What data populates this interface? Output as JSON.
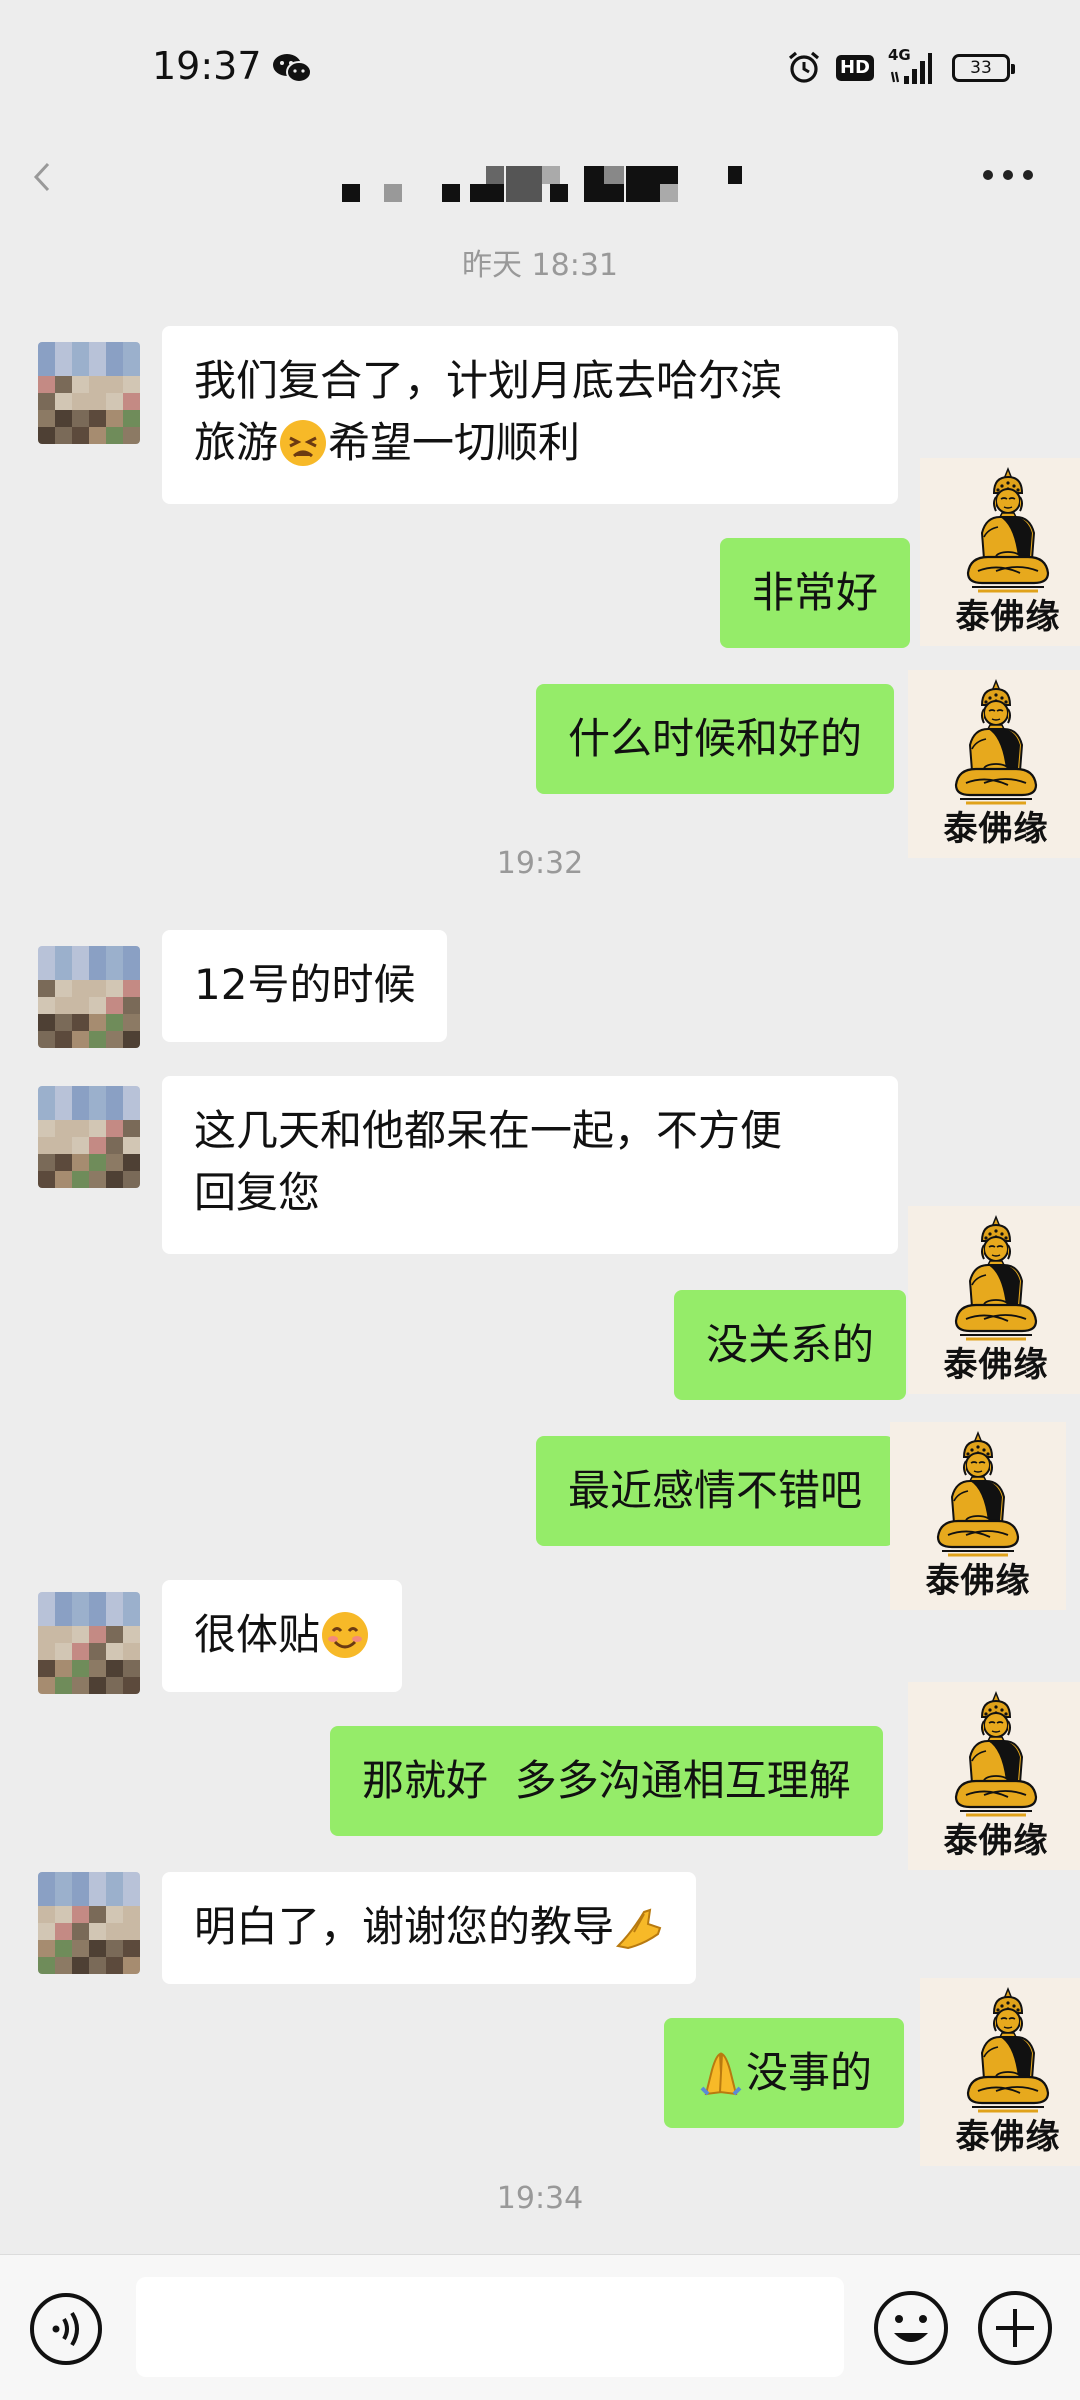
{
  "status_bar": {
    "time": "19:37",
    "app_notification_icon": "wechat-icon",
    "hd_label": "HD",
    "network_label": "4G",
    "battery_level": "33"
  },
  "header": {
    "back_icon": "chevron-left-icon",
    "contact_name": "",
    "more_icon": "more-dots-icon"
  },
  "timestamps": [
    "昨天 18:31",
    "19:32",
    "19:34"
  ],
  "me": {
    "avatar_label": "泰佛缘"
  },
  "messages": [
    {
      "sender": "contact",
      "lines": [
        "我们复合了，计划月底去哈尔滨",
        "旅游",
        "希望一切顺利"
      ],
      "emoji": "tired-face-emoji"
    },
    {
      "sender": "me",
      "text": "非常好"
    },
    {
      "sender": "me",
      "text": "什么时候和好的"
    },
    {
      "sender": "contact",
      "text": "12号的时候"
    },
    {
      "sender": "contact",
      "lines": [
        "这几天和他都呆在一起，不方便",
        "回复您"
      ]
    },
    {
      "sender": "me",
      "text": "没关系的"
    },
    {
      "sender": "me",
      "text": "最近感情不错吧"
    },
    {
      "sender": "contact",
      "text": "很体贴",
      "emoji": "smiling-face-emoji"
    },
    {
      "sender": "me",
      "text": "那就好  多多沟通相互理解"
    },
    {
      "sender": "contact",
      "text": "明白了，谢谢您的教导",
      "emoji": "folded-hands-emoji"
    },
    {
      "sender": "me",
      "text": "没事的",
      "emoji": "folded-hands-emoji"
    }
  ],
  "input_bar": {
    "voice_icon": "voice-icon",
    "input_value": "",
    "emoji_icon": "smiley-icon",
    "plus_icon": "plus-circle-icon"
  },
  "colors": {
    "background": "#ededed",
    "incoming_bubble": "#ffffff",
    "outgoing_bubble": "#95ec69",
    "timestamp": "#999999"
  }
}
